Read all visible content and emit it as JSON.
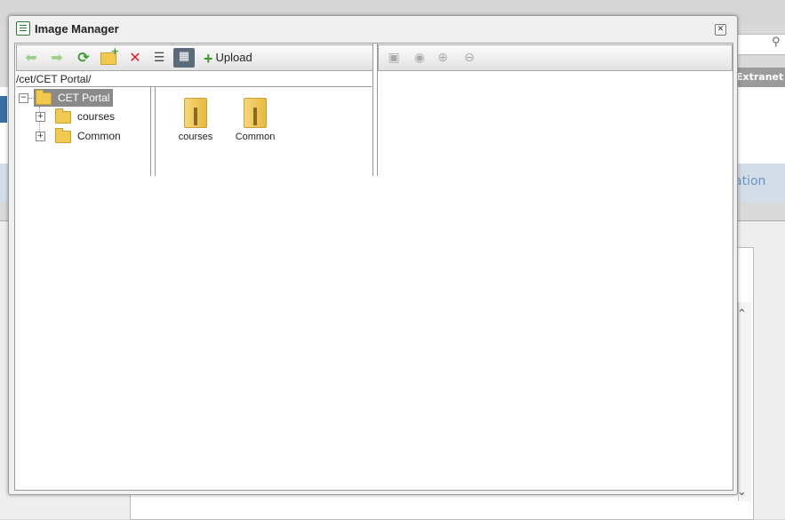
{
  "background": {
    "nav_tab_fragment": "ation",
    "extranet_label": "Extranet"
  },
  "dialog": {
    "title": "Image Manager",
    "close_glyph": "✕"
  },
  "toolbar": {
    "upload_label": "Upload",
    "buttons": [
      {
        "name": "back",
        "icon": "arrow-left-icon"
      },
      {
        "name": "forward",
        "icon": "arrow-right-icon"
      },
      {
        "name": "refresh",
        "icon": "refresh-icon"
      },
      {
        "name": "new-folder",
        "icon": "new-folder-icon"
      },
      {
        "name": "delete",
        "icon": "delete-icon"
      },
      {
        "name": "list-view",
        "icon": "list-view-icon"
      },
      {
        "name": "thumbnail-view",
        "icon": "thumbnail-view-icon",
        "active": true
      }
    ]
  },
  "preview_toolbar": {
    "buttons": [
      {
        "name": "best-fit",
        "icon": "fit-icon"
      },
      {
        "name": "actual-size",
        "icon": "actual-size-icon"
      },
      {
        "name": "zoom-in",
        "icon": "zoom-in-icon"
      },
      {
        "name": "zoom-out",
        "icon": "zoom-out-icon"
      }
    ]
  },
  "path": "/cet/CET Portal/",
  "tree": {
    "root": "CET Portal",
    "children": [
      {
        "label": "courses"
      },
      {
        "label": "Common"
      }
    ]
  },
  "grid": {
    "items": [
      {
        "label": "courses"
      },
      {
        "label": "Common"
      }
    ]
  },
  "colors": {
    "selected_bg": "#8a8a8a",
    "folder": "#f2c94c",
    "accent_green": "#3a9a2a",
    "delete_red": "#e02020"
  }
}
